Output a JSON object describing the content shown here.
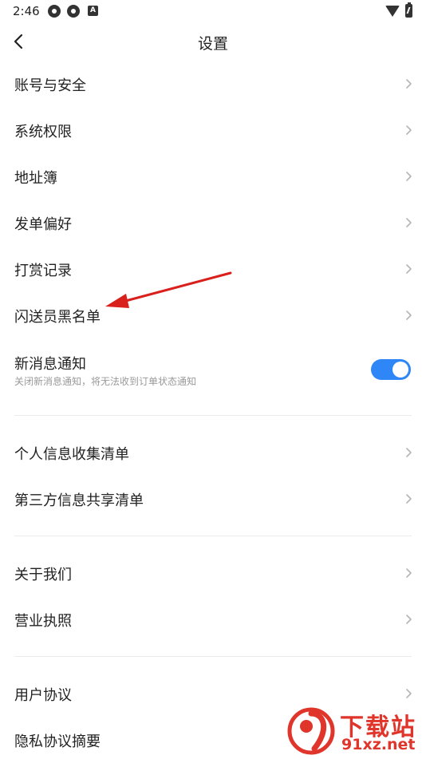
{
  "status_bar": {
    "time": "2:46",
    "icons": [
      "app-notification-icon",
      "app-notification-icon",
      "a-badge-icon",
      "wifi-icon",
      "battery-charging-icon"
    ],
    "a_badge": "A"
  },
  "header": {
    "title": "设置",
    "back_icon": "chevron-left-icon"
  },
  "settings": {
    "items": [
      {
        "label": "账号与安全"
      },
      {
        "label": "系统权限"
      },
      {
        "label": "地址簿"
      },
      {
        "label": "发单偏好"
      },
      {
        "label": "打赏记录"
      },
      {
        "label": "闪送员黑名单"
      }
    ],
    "notification": {
      "title": "新消息通知",
      "subtitle": "关闭新消息通知，将无法收到订单状态通知",
      "enabled": true
    },
    "privacy_items": [
      {
        "label": "个人信息收集清单"
      },
      {
        "label": "第三方信息共享清单"
      }
    ],
    "about_items": [
      {
        "label": "关于我们"
      },
      {
        "label": "营业执照"
      }
    ],
    "legal_items": [
      {
        "label": "用户协议"
      },
      {
        "label": "隐私协议摘要"
      }
    ]
  },
  "colors": {
    "toggle_on": "#2f86f6",
    "annotation_arrow": "#d9201c",
    "watermark": "#e0352b"
  },
  "watermark": {
    "title": "下载站",
    "url": "91xz.net",
    "logo_text": "9"
  }
}
